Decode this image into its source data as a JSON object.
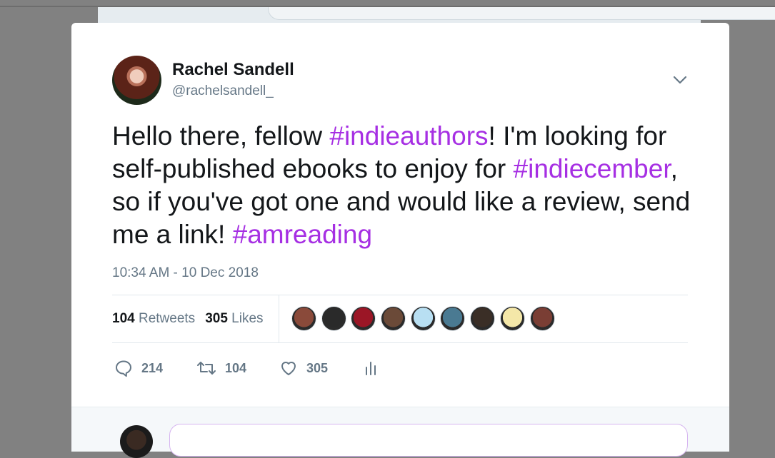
{
  "tweet": {
    "author": {
      "name": "Rachel Sandell",
      "handle": "@rachelsandell_"
    },
    "text_segments": [
      {
        "text": "Hello there, fellow ",
        "hashtag": false
      },
      {
        "text": "#indieauthors",
        "hashtag": true
      },
      {
        "text": "! I'm looking for self-published ebooks to enjoy for ",
        "hashtag": false
      },
      {
        "text": "#indiecember",
        "hashtag": true
      },
      {
        "text": ", so if you've got one and would like a review, send me a link! ",
        "hashtag": false
      },
      {
        "text": "#amreading",
        "hashtag": true
      }
    ],
    "timestamp": "10:34 AM - 10 Dec 2018",
    "stats": {
      "retweets_count": "104",
      "retweets_label": "Retweets",
      "likes_count": "305",
      "likes_label": "Likes"
    },
    "likers": [
      {
        "icon": "liker-avatar",
        "color": "#8a4a3a"
      },
      {
        "icon": "liker-avatar",
        "color": "#2a2a2a"
      },
      {
        "icon": "liker-avatar",
        "color": "#9b1626"
      },
      {
        "icon": "liker-avatar",
        "color": "#6b4a38"
      },
      {
        "icon": "liker-avatar",
        "color": "#b8dff2"
      },
      {
        "icon": "liker-avatar",
        "color": "#4a7a92"
      },
      {
        "icon": "liker-avatar",
        "color": "#3a2e26"
      },
      {
        "icon": "liker-avatar",
        "color": "#f4e7a8"
      },
      {
        "icon": "liker-avatar",
        "color": "#7a3e34"
      }
    ],
    "actions": {
      "reply_count": "214",
      "retweet_count": "104",
      "like_count": "305"
    }
  },
  "colors": {
    "hashtag": "#a62fe3",
    "secondary_text": "#657786",
    "primary_text": "#14171a",
    "overlay": "#818181"
  }
}
